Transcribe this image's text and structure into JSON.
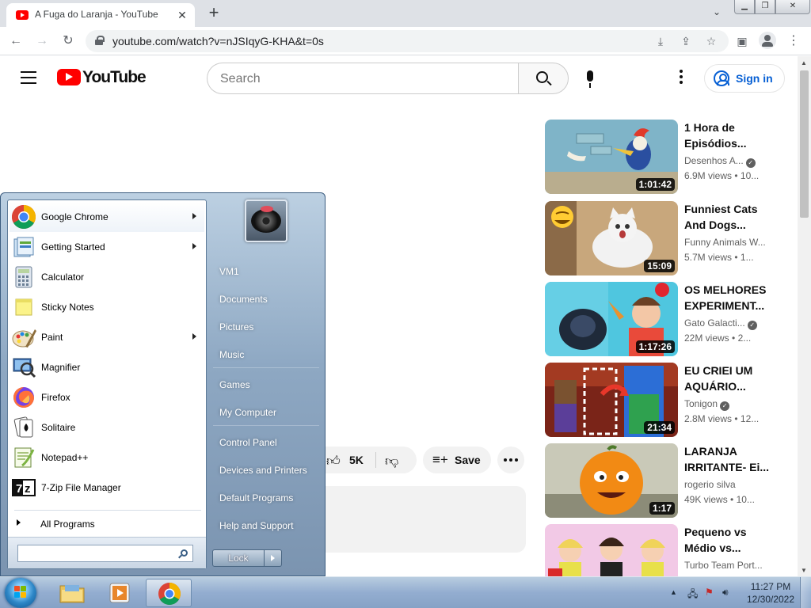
{
  "browser": {
    "tab_title": "A Fuga do Laranja - YouTube",
    "url": "youtube.com/watch?v=nJSIqyG-KHA&t=0s"
  },
  "youtube": {
    "logo_text": "YouTube",
    "search_placeholder": "Search",
    "sign_in": "Sign in",
    "likes": "5K",
    "save": "Save"
  },
  "related": [
    {
      "title": "1 Hora de Episódios...",
      "channel": "Desenhos A...",
      "verified": true,
      "views": "6.9M views",
      "age": "10...",
      "duration": "1:01:42"
    },
    {
      "title": "Funniest Cats And Dogs...",
      "channel": "Funny Animals W...",
      "verified": false,
      "views": "5.7M views",
      "age": "1...",
      "duration": "15:09"
    },
    {
      "title": "OS MELHORES EXPERIMENT...",
      "channel": "Gato Galacti...",
      "verified": true,
      "views": "22M views",
      "age": "2...",
      "duration": "1:17:26"
    },
    {
      "title": "EU CRIEI UM AQUÁRIO...",
      "channel": "Tonigon",
      "verified": true,
      "views": "2.8M views",
      "age": "12...",
      "duration": "21:34"
    },
    {
      "title": "LARANJA IRRITANTE- Ei...",
      "channel": "rogerio silva",
      "verified": false,
      "views": "49K views",
      "age": "10...",
      "duration": "1:17"
    },
    {
      "title": "Pequeno vs Médio vs...",
      "channel": "Turbo Team Port...",
      "verified": false,
      "views": "",
      "age": "",
      "duration": ""
    }
  ],
  "start_menu": {
    "programs": [
      {
        "label": "Google Chrome",
        "icon": "chrome-icon",
        "submenu": true
      },
      {
        "label": "Getting Started",
        "icon": "getting-started-icon",
        "submenu": true
      },
      {
        "label": "Calculator",
        "icon": "calculator-icon",
        "submenu": false
      },
      {
        "label": "Sticky Notes",
        "icon": "sticky-notes-icon",
        "submenu": false
      },
      {
        "label": "Paint",
        "icon": "paint-icon",
        "submenu": true
      },
      {
        "label": "Magnifier",
        "icon": "magnifier-icon",
        "submenu": false
      },
      {
        "label": "Firefox",
        "icon": "firefox-icon",
        "submenu": false
      },
      {
        "label": "Solitaire",
        "icon": "solitaire-icon",
        "submenu": false
      },
      {
        "label": "Notepad++",
        "icon": "notepad-plus-plus-icon",
        "submenu": false
      },
      {
        "label": "7-Zip File Manager",
        "icon": "seven-zip-icon",
        "submenu": false
      }
    ],
    "all_programs": "All Programs",
    "right_links": [
      "VM1",
      "Documents",
      "Pictures",
      "Music",
      "Games",
      "My Computer",
      "Control Panel",
      "Devices and Printers",
      "Default Programs",
      "Help and Support"
    ],
    "lock": "Lock"
  },
  "taskbar": {
    "time": "11:27 PM",
    "date": "12/30/2022"
  },
  "colors": {
    "youtube_red": "#ff0000",
    "signin_blue": "#065fd4",
    "startmenu_glass": "#8ea8c3"
  }
}
